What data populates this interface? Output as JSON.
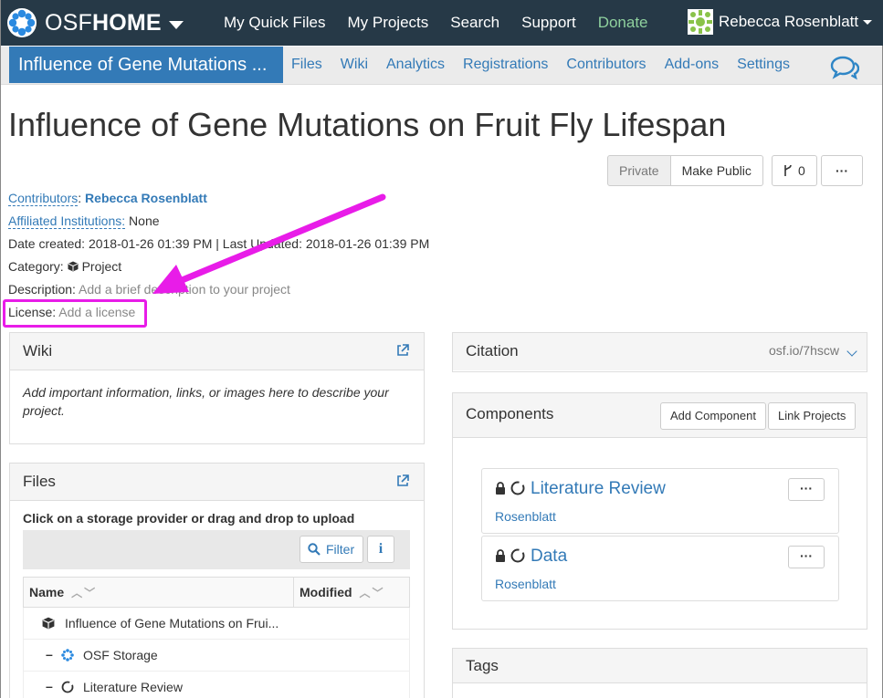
{
  "topnav": {
    "brand_prefix": "OSF",
    "brand_suffix": "HOME",
    "links": [
      {
        "label": "My Quick Files"
      },
      {
        "label": "My Projects"
      },
      {
        "label": "Search"
      },
      {
        "label": "Support"
      },
      {
        "label": "Donate"
      }
    ],
    "user_name": "Rebecca Rosenblatt"
  },
  "project_nav": {
    "title": "Influence of Gene Mutations ...",
    "links": [
      "Files",
      "Wiki",
      "Analytics",
      "Registrations",
      "Contributors",
      "Add-ons",
      "Settings"
    ]
  },
  "project": {
    "title": "Influence of Gene Mutations on Fruit Fly Lifespan",
    "privacy_label": "Private",
    "make_public_label": "Make Public",
    "fork_count": "0",
    "more_label": "···",
    "contributors_label": "Contributors",
    "contributors_value": "Rebecca Rosenblatt",
    "institutions_label": "Affiliated Institutions:",
    "institutions_value": "None",
    "dates": "Date created: 2018-01-26 01:39 PM | Last Updated: 2018-01-26 01:39 PM",
    "category_label": "Category:",
    "category_value": "Project",
    "description_label": "Description:",
    "description_value": "Add a brief description to your project",
    "license_label": "License:",
    "license_value": "Add a license"
  },
  "wiki": {
    "title": "Wiki",
    "placeholder": "Add important information, links, or images here to describe your project."
  },
  "files": {
    "title": "Files",
    "instruction": "Click on a storage provider or drag and drop to upload",
    "filter_label": "Filter",
    "info_label": "i",
    "columns": [
      "Name",
      "Modified"
    ],
    "rows": [
      {
        "name": "Influence of Gene Mutations on Frui..."
      },
      {
        "name": "OSF Storage"
      },
      {
        "name": "Literature Review"
      }
    ]
  },
  "citation": {
    "title": "Citation",
    "url": "osf.io/7hscw"
  },
  "components": {
    "title": "Components",
    "add_label": "Add Component",
    "link_label": "Link Projects",
    "items": [
      {
        "title": "Literature Review",
        "author": "Rosenblatt"
      },
      {
        "title": "Data",
        "author": "Rosenblatt"
      }
    ]
  },
  "tags": {
    "title": "Tags"
  },
  "colors": {
    "navbar": "#263947",
    "accent": "#337ab7",
    "highlight": "#e81ce8",
    "donate": "#8fd19e"
  }
}
